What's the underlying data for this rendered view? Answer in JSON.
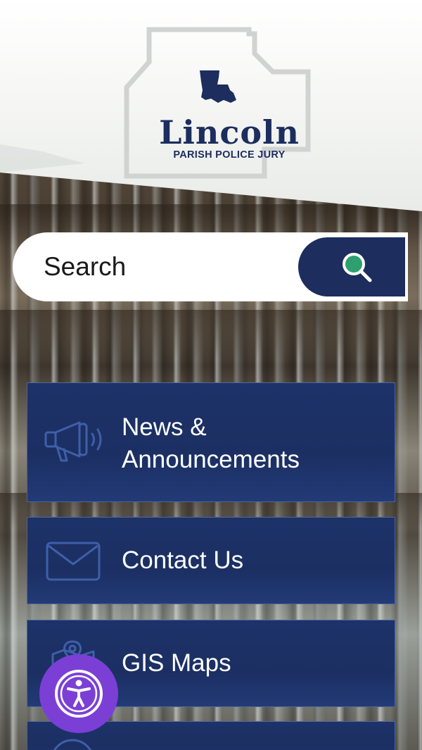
{
  "header": {
    "logo_title": "Lincoln",
    "logo_subtitle": "PARISH POLICE JURY"
  },
  "search": {
    "placeholder": "Search",
    "button_icon": "search-icon"
  },
  "menu": {
    "items": [
      {
        "label": "News &\nAnnouncements",
        "icon": "megaphone-icon"
      },
      {
        "label": "Contact Us",
        "icon": "envelope-icon"
      },
      {
        "label": "GIS Maps",
        "icon": "map-pin-icon"
      }
    ]
  },
  "accessibility": {
    "icon": "accessibility-icon"
  },
  "colors": {
    "navy": "#1c2d5e",
    "accessibility_purple": "#7b3fd6",
    "search_lens": "#2e9f6e"
  }
}
